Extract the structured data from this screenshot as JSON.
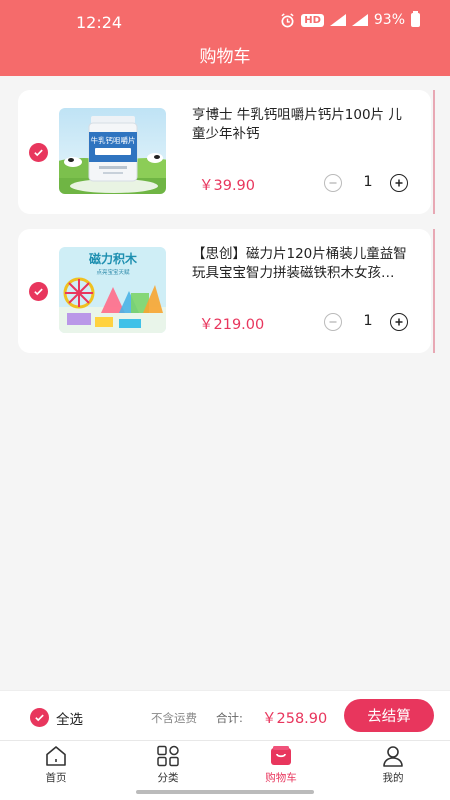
{
  "status_bar": {
    "time": "12:24",
    "network": "HD",
    "sim1": "4G",
    "sim2": "4G",
    "battery": "93%"
  },
  "header": {
    "title": "购物车"
  },
  "cart": {
    "items": [
      {
        "title": "亨博士 牛乳钙咀嚼片钙片100片 儿童少年补钙",
        "price": "￥39.90",
        "quantity": "1",
        "checked": true,
        "image_text": "牛乳钙咀嚼片",
        "image_icon": "milk-calcium-bottle-image"
      },
      {
        "title": "【思创】磁力片120片桶装儿童益智玩具宝宝智力拼装磁铁积木女孩…",
        "price": "￥219.00",
        "quantity": "1",
        "checked": true,
        "image_text": "磁力积木",
        "image_subtext": "点亮宝宝天赋",
        "image_icon": "magnetic-blocks-image"
      }
    ]
  },
  "checkout": {
    "select_all": "全选",
    "shipping_note": "不含运费",
    "total_label": "合计:",
    "total_value": "￥258.90",
    "button": "去结算",
    "accent": "#e8365d"
  },
  "tabbar": {
    "items": [
      {
        "label": "首页",
        "icon": "home-icon"
      },
      {
        "label": "分类",
        "icon": "category-grid-icon"
      },
      {
        "label": "购物车",
        "icon": "cart-icon",
        "active": true
      },
      {
        "label": "我的",
        "icon": "user-icon"
      }
    ]
  },
  "colors": {
    "header": "#f56b6b",
    "accent": "#e8365d",
    "background": "#f5f5f5"
  }
}
